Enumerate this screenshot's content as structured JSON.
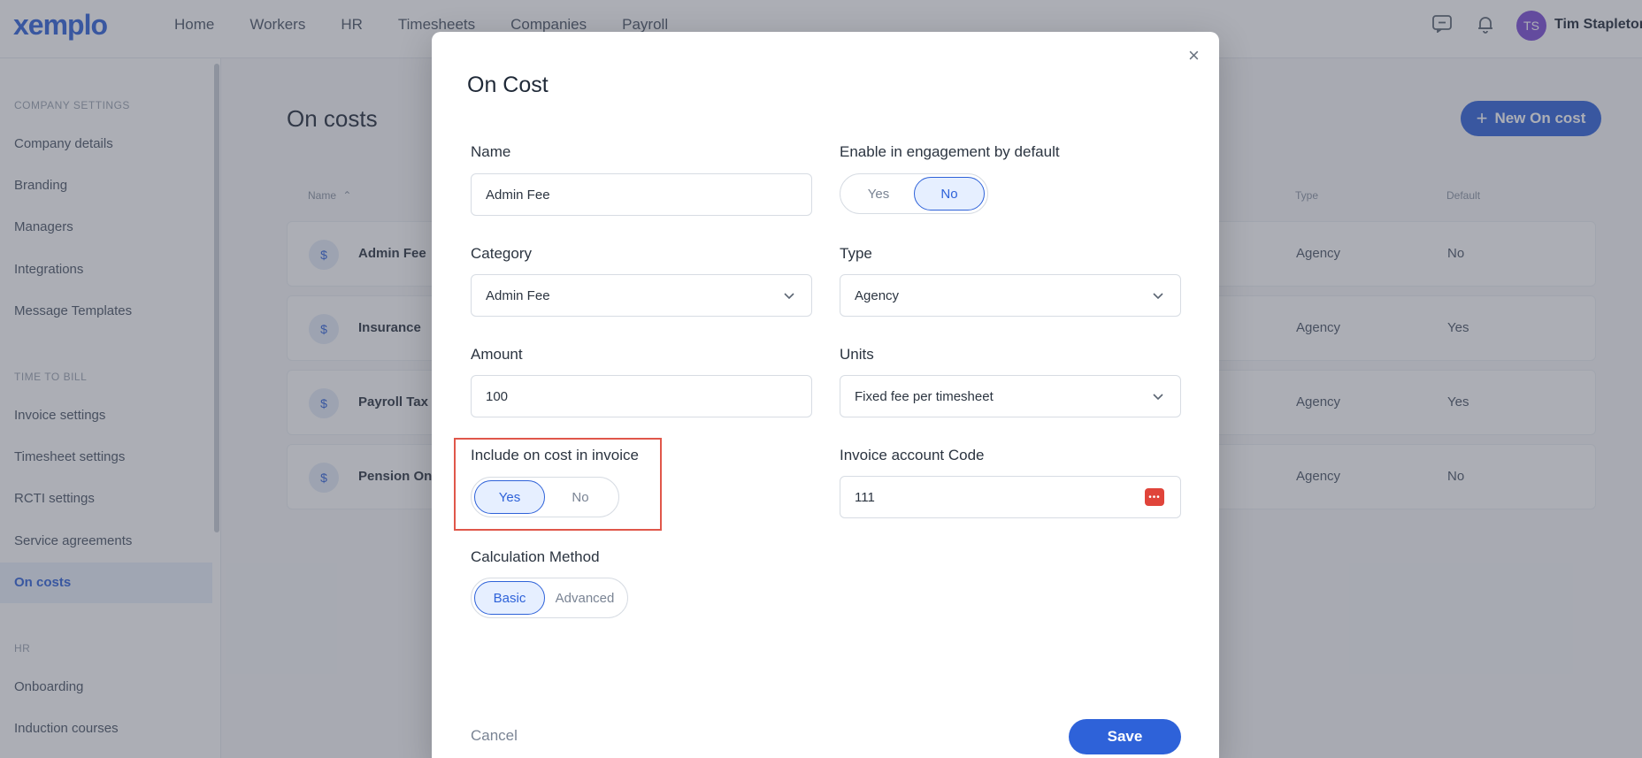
{
  "app": {
    "logo": "xemplo",
    "nav": [
      "Home",
      "Workers",
      "HR",
      "Timesheets",
      "Companies",
      "Payroll"
    ],
    "user": {
      "initials": "TS",
      "name": "Tim Stapleton"
    }
  },
  "sidebar": {
    "sections": [
      {
        "title": "COMPANY SETTINGS",
        "items": [
          "Company details",
          "Branding",
          "Managers",
          "Integrations",
          "Message Templates"
        ]
      },
      {
        "title": "TIME TO BILL",
        "items": [
          "Invoice settings",
          "Timesheet settings",
          "RCTI settings",
          "Service agreements",
          "On costs"
        ]
      },
      {
        "title": "HR",
        "items": [
          "Onboarding",
          "Induction courses"
        ]
      }
    ],
    "active": "On costs"
  },
  "page": {
    "title": "On costs",
    "new_button": "New On cost",
    "columns": {
      "name": "Name",
      "type": "Type",
      "default": "Default"
    },
    "rows": [
      {
        "name": "Admin Fee",
        "type": "Agency",
        "default": "No"
      },
      {
        "name": "Insurance",
        "type": "Agency",
        "default": "Yes"
      },
      {
        "name": "Payroll Tax",
        "type": "Agency",
        "default": "Yes"
      },
      {
        "name": "Pension On-",
        "type": "Agency",
        "default": "No"
      }
    ]
  },
  "modal": {
    "title": "On Cost",
    "close": "×",
    "name": {
      "label": "Name",
      "value": "Admin Fee"
    },
    "enable_default": {
      "label": "Enable in engagement by default",
      "options": [
        "Yes",
        "No"
      ],
      "selected": "No"
    },
    "category": {
      "label": "Category",
      "value": "Admin Fee"
    },
    "type": {
      "label": "Type",
      "value": "Agency"
    },
    "amount": {
      "label": "Amount",
      "value": "100"
    },
    "units": {
      "label": "Units",
      "value": "Fixed fee per timesheet"
    },
    "include_invoice": {
      "label": "Include on cost in invoice",
      "options": [
        "Yes",
        "No"
      ],
      "selected": "Yes"
    },
    "invoice_code": {
      "label": "Invoice account Code",
      "value": "111"
    },
    "calc_method": {
      "label": "Calculation Method",
      "options": [
        "Basic",
        "Advanced"
      ],
      "selected": "Basic"
    },
    "cancel": "Cancel",
    "save": "Save"
  },
  "colors": {
    "brand": "#2e62d9",
    "highlight": "#e0574a"
  }
}
